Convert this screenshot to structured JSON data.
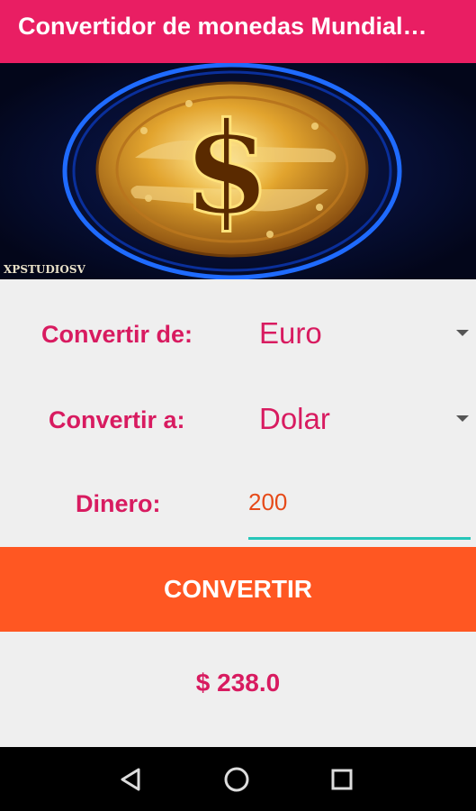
{
  "app": {
    "title": "Convertidor de monedas Mundial…"
  },
  "banner": {
    "watermark": "XPSTUDIOSV",
    "coin_symbol": "$",
    "icon": "dollar-coin-icon"
  },
  "form": {
    "from_label": "Convertir de:",
    "from_value": "Euro",
    "to_label": "Convertir a:",
    "to_value": "Dolar",
    "amount_label": "Dinero:",
    "amount_value": "200"
  },
  "actions": {
    "convert_label": "CONVERTIR"
  },
  "result": {
    "text": "$ 238.0"
  },
  "navbar": {
    "back_icon": "back-triangle-icon",
    "home_icon": "home-circle-icon",
    "recents_icon": "recents-square-icon"
  },
  "colors": {
    "primary": "#e91e63",
    "accent": "#ff5722",
    "label": "#d81b60",
    "underline": "#26c6b9"
  }
}
